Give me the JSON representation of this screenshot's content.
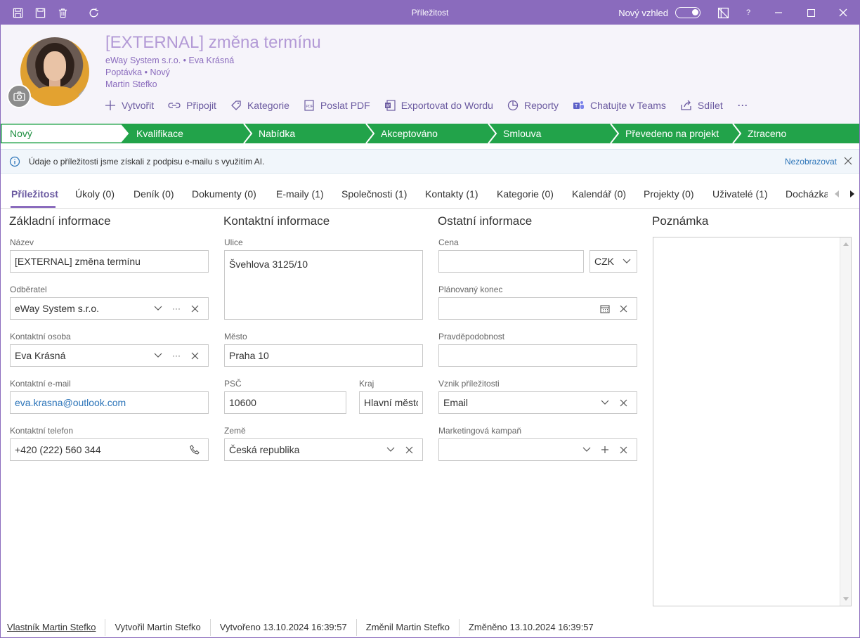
{
  "window": {
    "title": "Příležitost",
    "new_look_label": "Nový vzhled",
    "help_label": "?"
  },
  "colors": {
    "accent": "#8a6bbd",
    "process_green": "#22a34a",
    "link": "#2a73b8"
  },
  "header": {
    "title": "[EXTERNAL] změna termínu",
    "line1": "eWay System s.r.o. • Eva Krásná",
    "line2": "Poptávka • Nový",
    "line3": "Martin Stefko"
  },
  "actions": [
    {
      "label": "Vytvořit",
      "icon": "plus-icon"
    },
    {
      "label": "Připojit",
      "icon": "link-icon"
    },
    {
      "label": "Kategorie",
      "icon": "tag-icon"
    },
    {
      "label": "Poslat PDF",
      "icon": "pdf-icon"
    },
    {
      "label": "Exportovat do Wordu",
      "icon": "word-icon"
    },
    {
      "label": "Reporty",
      "icon": "pie-chart-icon"
    },
    {
      "label": "Chatujte v Teams",
      "icon": "teams-icon"
    },
    {
      "label": "Sdílet",
      "icon": "share-icon"
    },
    {
      "label": "···",
      "icon": "more-icon"
    }
  ],
  "process": {
    "steps": [
      "Nový",
      "Kvalifikace",
      "Nabídka",
      "Akceptováno",
      "Smlouva",
      "Převedeno na projekt",
      "Ztraceno"
    ],
    "current": "Nový"
  },
  "info": {
    "text": "Údaje o příležitosti jsme získali z podpisu e-mailu s využitím AI.",
    "hide_label": "Nezobrazovat"
  },
  "tabs": [
    "Příležitost",
    "Úkoly (0)",
    "Deník (0)",
    "Dokumenty (0)",
    "E-maily (1)",
    "Společnosti (1)",
    "Kontakty (1)",
    "Kategorie (0)",
    "Kalendář (0)",
    "Projekty (0)",
    "Uživatelé (1)",
    "Docházka"
  ],
  "basic": {
    "title": "Základní informace",
    "name_label": "Název",
    "name_value": "[EXTERNAL] změna termínu",
    "customer_label": "Odběratel",
    "customer_value": "eWay System s.r.o.",
    "contact_label": "Kontaktní osoba",
    "contact_value": "Eva Krásná",
    "email_label": "Kontaktní e-mail",
    "email_value": "eva.krasna@outlook.com",
    "phone_label": "Kontaktní telefon",
    "phone_value": "+420 (222) 560 344"
  },
  "contact": {
    "title": "Kontaktní informace",
    "street_label": "Ulice",
    "street_value": "Švehlova 3125/10",
    "city_label": "Město",
    "city_value": "Praha 10",
    "zip_label": "PSČ",
    "zip_value": "10600",
    "region_label": "Kraj",
    "region_value": "Hlavní město",
    "country_label": "Země",
    "country_value": "Česká republika"
  },
  "other": {
    "title": "Ostatní informace",
    "price_label": "Cena",
    "price_value": "",
    "currency_value": "CZK",
    "end_label": "Plánovaný konec",
    "end_value": "",
    "prob_label": "Pravděpodobnost",
    "prob_value": "",
    "origin_label": "Vznik příležitosti",
    "origin_value": "Email",
    "campaign_label": "Marketingová kampaň",
    "campaign_value": ""
  },
  "note": {
    "title": "Poznámka",
    "value": ""
  },
  "footer": {
    "owner": "Vlastník Martin Stefko",
    "created_by": "Vytvořil Martin Stefko",
    "created_at": "Vytvořeno 13.10.2024 16:39:57",
    "changed_by": "Změnil Martin Stefko",
    "changed_at": "Změněno 13.10.2024 16:39:57"
  }
}
